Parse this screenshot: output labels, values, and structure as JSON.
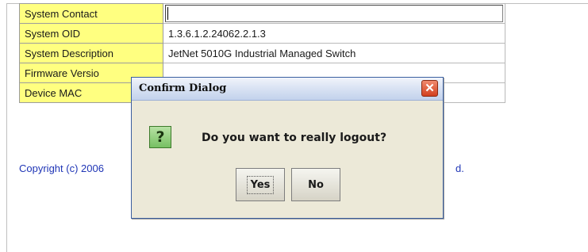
{
  "info_rows": [
    {
      "label": "System Contact",
      "value": ""
    },
    {
      "label": "System OID",
      "value": "1.3.6.1.2.24062.2.1.3"
    },
    {
      "label": "System Description",
      "value": "JetNet 5010G Industrial Managed Switch"
    },
    {
      "label": "Firmware Versio",
      "value": ""
    },
    {
      "label": "Device MAC",
      "value": ""
    }
  ],
  "copyright": "Copyright (c) 2006",
  "copyright_tail": "d.",
  "dialog": {
    "title": "Confirm Dialog",
    "close_glyph": "✕",
    "icon_glyph": "?",
    "message": "Do you want to really logout?",
    "yes_label": "Yes",
    "no_label": "No"
  }
}
